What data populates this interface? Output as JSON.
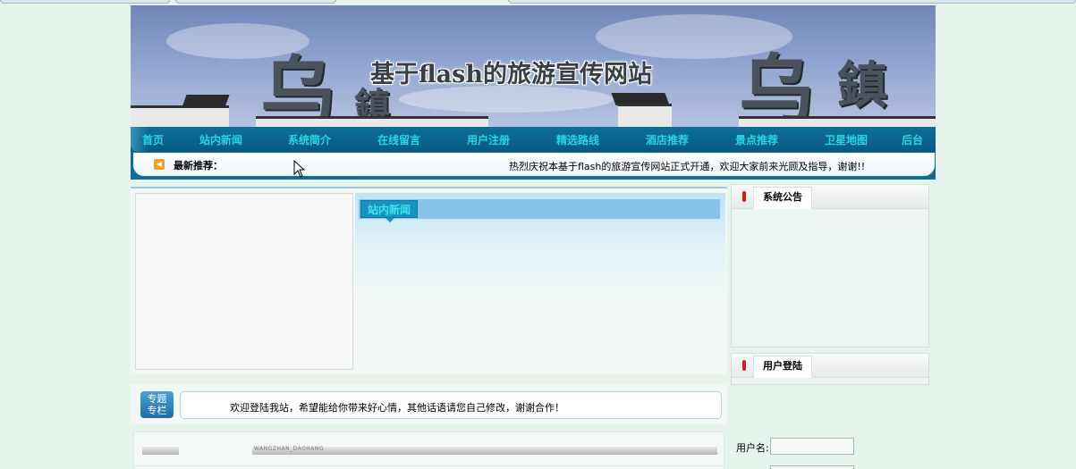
{
  "banner": {
    "title": "基于flash的旅游宣传网站"
  },
  "nav": {
    "items": [
      "首页",
      "站内新闻",
      "系统简介",
      "在线留言",
      "用户注册",
      "精选路线",
      "酒店推荐",
      "景点推荐",
      "卫星地图",
      "后台"
    ]
  },
  "newsbar": {
    "label": "最新推荐：",
    "marquee": "热烈庆祝本基于flash的旅游宣传网站正式开通，欢迎大家前来光顾及指导，谢谢!!"
  },
  "news_panel": {
    "tab_label": "站内新闻"
  },
  "zhuanlan": {
    "icon_text_line1": "专题",
    "icon_text_line2": "专栏",
    "message": "欢迎登陆我站，希望能给你带来好心情，其他话语请您自己修改，谢谢合作！"
  },
  "bottom_block": {
    "caption": "WANGZHAN_DAOHANG"
  },
  "sidebar": {
    "notice_title": "系统公告",
    "login_title": "用户登陆",
    "username_label": "用户名:",
    "username_value": "",
    "password_value": ""
  },
  "colors": {
    "page_bg": "#e6f4ec",
    "nav_bg": "#0b6690",
    "nav_text": "#24d7e8",
    "tab_bg": "#1693c4",
    "marker_red": "#d21c1c"
  }
}
